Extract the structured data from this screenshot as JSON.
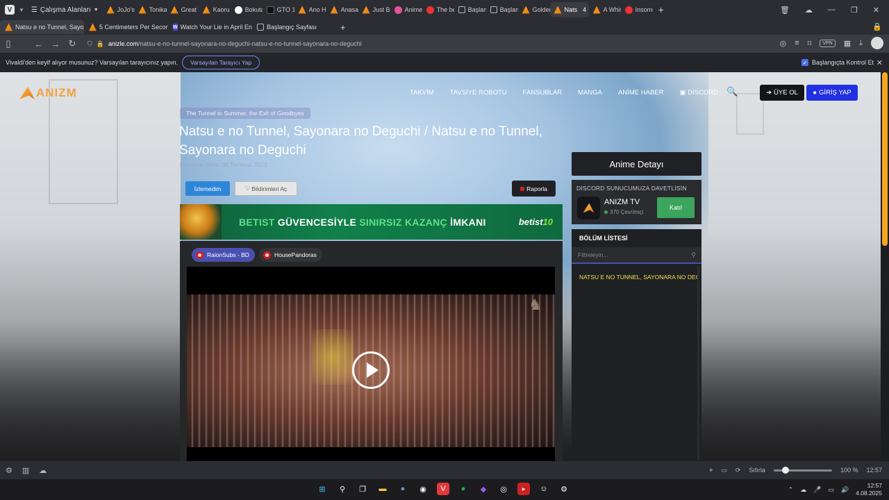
{
  "browser": {
    "workspaces_label": "Çalışma Alanları",
    "top_tabs": [
      {
        "label": "JoJo's Bi",
        "icon": "anime"
      },
      {
        "label": "Tonikaku",
        "icon": "anime"
      },
      {
        "label": "Great Te",
        "icon": "anime"
      },
      {
        "label": "Kaoru Ha",
        "icon": "anime"
      },
      {
        "label": "Bokutac",
        "icon": "bok"
      },
      {
        "label": "GTO 1.Se",
        "icon": "dark"
      },
      {
        "label": "Ano Han",
        "icon": "anime"
      },
      {
        "label": "Anasayfa",
        "icon": "anime"
      },
      {
        "label": "Just Bec",
        "icon": "anime"
      },
      {
        "label": "AnimeW",
        "icon": "pink"
      },
      {
        "label": "The best",
        "icon": "red"
      },
      {
        "label": "Başlangı",
        "icon": "grid"
      },
      {
        "label": "Başlangı",
        "icon": "grid"
      },
      {
        "label": "Golden T",
        "icon": "anime"
      },
      {
        "label": "Nats",
        "icon": "anime",
        "count": "4",
        "active": true
      },
      {
        "label": "A Whisk",
        "icon": "anime"
      },
      {
        "label": "Insomni",
        "icon": "red"
      }
    ],
    "second_tabs": [
      {
        "label": "Natsu e no Tunnel, Sayonar",
        "icon": "anime",
        "active": true
      },
      {
        "label": "5 Centimeters Per Second",
        "icon": "anime"
      },
      {
        "label": "Watch Your Lie in April Eng",
        "icon": "w"
      },
      {
        "label": "Başlangıç Sayfası",
        "icon": "grid"
      }
    ],
    "url_domain": "anizle.com",
    "url_path": "/natsu-e-no-tunnel-sayonara-no-deguchi-natsu-e-no-tunnel-sayonara-no-deguchi",
    "vpn_label": "VPN",
    "notification": {
      "message": "Vivaldi'den keyif alıyor musunuz? Varsayılan tarayıcınız yapın.",
      "button": "Varsayılan Tarayıcı Yap",
      "checkbox_label": "Başlangıçta Kontrol Et"
    }
  },
  "site": {
    "logo_text": "ANIZM",
    "nav": [
      "TAKVİM",
      "TAVSİYE ROBOTU",
      "FANSUBLAR",
      "MANGA",
      "ANİME HABER",
      "DİSCORD"
    ],
    "signup_label": "ÜYE OL",
    "login_label": "GİRİŞ YAP"
  },
  "anime": {
    "alt_title": "The Tunnel to Summer, the Exit of Goodbyes",
    "title": "Natsu e no Tunnel, Sayonara no Deguchi / Natsu e no Tunnel, Sayonara no Deguchi",
    "date": "Eklenme Tarihi: 05 Temmuz 2023",
    "watched_label": "İzlemedim",
    "notify_label": "Bildirimleri Aç",
    "report_label": "Raporla"
  },
  "ad": {
    "text_1": "BETIST",
    "text_2": "GÜVENCESİYLE",
    "text_3": "SINIRSIZ KAZANÇ",
    "text_4": "İMKANI",
    "brand": "betist",
    "brand_num": "10"
  },
  "fansubs": [
    {
      "label": "RaionSubs - BD",
      "active": true
    },
    {
      "label": "HousePandoras",
      "active": false
    }
  ],
  "sidebar": {
    "detail_title": "Anime Detayı",
    "discord_title": "DISCORD SUNUCUMUZA DAVETLİSİN",
    "discord_name": "ANIZM TV",
    "discord_online": "370 Çevrimiçi",
    "discord_join": "Katıl",
    "episode_list_title": "BÖLÜM LİSTESİ",
    "filter_placeholder": "Filtreleyin...",
    "episodes": [
      "NATSU E NO TUNNEL, SAYONARA NO DEGUCHI"
    ]
  },
  "statusbar": {
    "reset_label": "Sıfırla",
    "zoom": "100 %",
    "time": "12:57"
  },
  "taskbar": {
    "time": "12:57",
    "date": "4.08.2025"
  }
}
